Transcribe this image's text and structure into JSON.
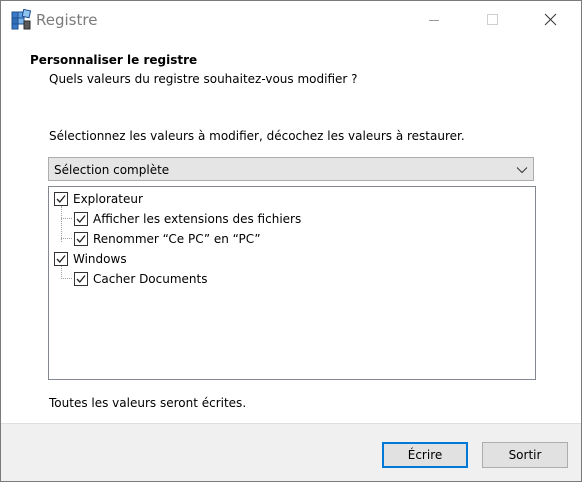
{
  "window": {
    "title": "Registre"
  },
  "header": {
    "title": "Personnaliser le registre",
    "subtitle": "Quels valeurs du registre souhaitez-vous modifier ?"
  },
  "instruction": "Sélectionnez les valeurs à modifier, décochez les valeurs à restaurer.",
  "selection_dropdown": {
    "selected": "Sélection complète"
  },
  "tree": {
    "items": [
      {
        "label": "Explorateur",
        "checked": true,
        "level": 0
      },
      {
        "label": "Afficher les extensions des fichiers",
        "checked": true,
        "level": 1
      },
      {
        "label": "Renommer “Ce PC” en “PC”",
        "checked": true,
        "level": 1
      },
      {
        "label": "Windows",
        "checked": true,
        "level": 0
      },
      {
        "label": "Cacher Documents",
        "checked": true,
        "level": 1
      }
    ]
  },
  "status_text": "Toutes les valeurs seront écrites.",
  "buttons": {
    "write": "Écrire",
    "exit": "Sortir"
  },
  "colors": {
    "accent": "#0078d7",
    "footer_bg": "#f0f0f0",
    "dropdown_bg": "#e5e5e5",
    "title_text": "#7b7b7b"
  },
  "icons": {
    "app": "registry-app-icon",
    "minimize": "minimize-icon",
    "maximize": "maximize-icon",
    "close": "close-icon",
    "dropdown": "chevron-down-icon",
    "checkbox": "checkmark-icon"
  }
}
